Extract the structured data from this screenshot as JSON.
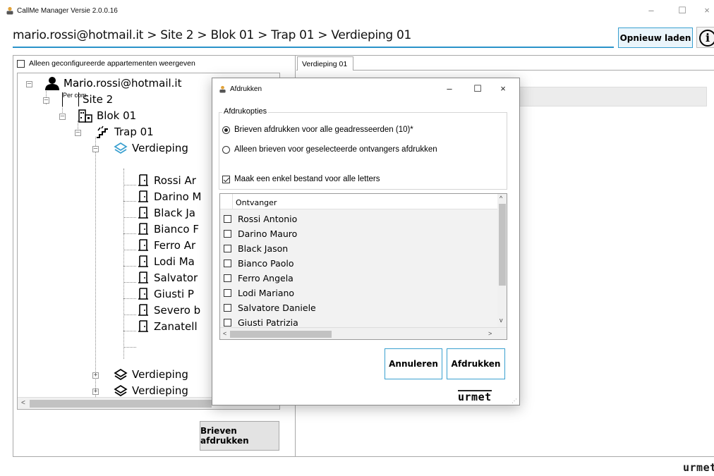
{
  "window": {
    "title": "CallMe Manager Versie 2.0.0.16",
    "minimize_glyph": "–",
    "maximize_glyph": "☐",
    "close_glyph": "×"
  },
  "header": {
    "breadcrumb": "mario.rossi@hotmail.it > Site 2 > Blok 01 > Trap 01 > Verdieping 01",
    "reload_label": "Opnieuw laden",
    "info_glyph": "i"
  },
  "left_panel": {
    "filter_label": "Alleen geconfigureerde appartementen weergeven",
    "filter_checked": false,
    "tree": {
      "user": "Mario.rossi@hotmail.it",
      "user_overlap": "Mario",
      "site": "Site 2",
      "site_icon_text": "Per com",
      "block": "Blok 01",
      "stair": "Trap 01",
      "floor_open": "Verdieping",
      "apartments": [
        "Rossi Ar",
        "Darino M",
        "Black Ja",
        "Bianco F",
        "Ferro Ar",
        "Lodi Ma",
        "Salvator",
        "Giusti P",
        "Severo b",
        "Zanatell"
      ],
      "floors_collapsed": [
        "Verdieping",
        "Verdieping"
      ]
    },
    "print_letters_button": "Brieven afdrukken"
  },
  "right_panel": {
    "tab_label": "Verdieping 01",
    "brand": "urmet"
  },
  "dialog": {
    "title": "Afdrukken",
    "group_label": "Afdrukopties",
    "option_all": "Brieven afdrukken voor alle geadresseerden (10)*",
    "option_selected": "Alleen brieven voor geselecteerde ontvangers afdrukken",
    "selected_option": "all",
    "single_file_label": "Maak een enkel bestand voor alle letters",
    "single_file_checked": true,
    "list_header": "Ontvanger",
    "recipients": [
      "Rossi Antonio",
      "Darino Mauro",
      "Black Jason",
      "Bianco Paolo",
      "Ferro Angela",
      "Lodi Mariano",
      "Salvatore Daniele",
      "Giusti Patrizia"
    ],
    "cancel_button": "Annuleren",
    "print_button": "Afdrukken",
    "brand": "urmet"
  },
  "colors": {
    "accent": "#2a93c9",
    "button_border": "#3aa0d0",
    "floor_icon": "#3aa0d0"
  }
}
